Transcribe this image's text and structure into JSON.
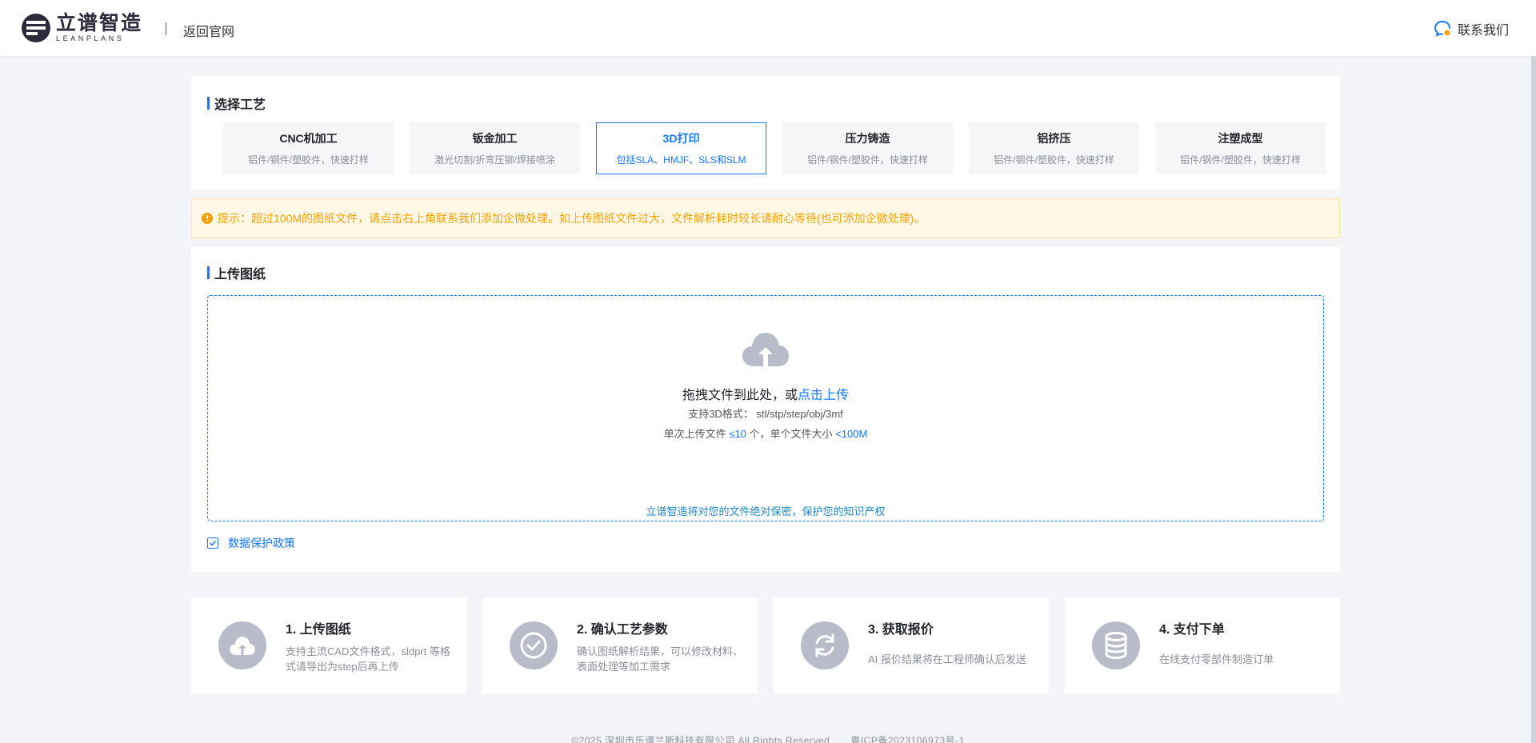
{
  "header": {
    "brand_cn": "立谱智造",
    "brand_en": "LEANPLANS",
    "back_label": "返回官网",
    "contact_label": "联系我们"
  },
  "process": {
    "title": "选择工艺",
    "items": [
      {
        "name": "CNC机加工",
        "desc": "铝件/钢件/塑胶件，快速打样",
        "active": false
      },
      {
        "name": "钣金加工",
        "desc": "激光切割/折弯压铆/焊接喷涂",
        "active": false
      },
      {
        "name": "3D打印",
        "desc": "包括SLA、HMJF、SLS和SLM",
        "active": true
      },
      {
        "name": "压力铸造",
        "desc": "铝件/钢件/塑胶件，快速打样",
        "active": false
      },
      {
        "name": "铝挤压",
        "desc": "铝件/钢件/塑胶件，快速打样",
        "active": false
      },
      {
        "name": "注塑成型",
        "desc": "铝件/钢件/塑胶件，快速打样",
        "active": false
      }
    ]
  },
  "notice": {
    "text": "提示：超过100M的图纸文件，请点击右上角联系我们添加企微处理。如上传图纸文件过大，文件解析耗时较长请耐心等待(也可添加企微处理)。"
  },
  "upload": {
    "title": "上传图纸",
    "drop_text": "拖拽文件到此处，或",
    "click_text": "点击上传",
    "formats": "支持3D格式： stl/stp/step/obj/3mf",
    "limit_prefix": "单次上传文件",
    "limit_count": "≤10",
    "limit_middle": "个，单个文件大小",
    "limit_size": "<100M",
    "secure_text": "立谱智造将对您的文件绝对保密，保护您的知识产权",
    "policy_label": "数据保护政策",
    "policy_checked": true
  },
  "steps": [
    {
      "title": "1. 上传图纸",
      "desc": "支持主流CAD文件格式，sldprt 等格式请导出为step后再上传",
      "icon": "cloud-upload-icon"
    },
    {
      "title": "2. 确认工艺参数",
      "desc": "确认图纸解析结果，可以修改材料、表面处理等加工需求",
      "icon": "check-circle-icon"
    },
    {
      "title": "3. 获取报价",
      "desc": "AI 报价结果将在工程师确认后发送",
      "icon": "refresh-icon"
    },
    {
      "title": "4. 支付下单",
      "desc": "在线支付零部件制造订单",
      "icon": "database-icon"
    }
  ],
  "footer": {
    "copyright": "©2025 深圳市乐谱兰斯科技有限公司 All Rights Reserved",
    "icp": "粤ICP备2023106973号-1"
  },
  "colors": {
    "accent": "#1677ff",
    "warning": "#f5a200",
    "icon_gray": "#b8bcc8"
  }
}
